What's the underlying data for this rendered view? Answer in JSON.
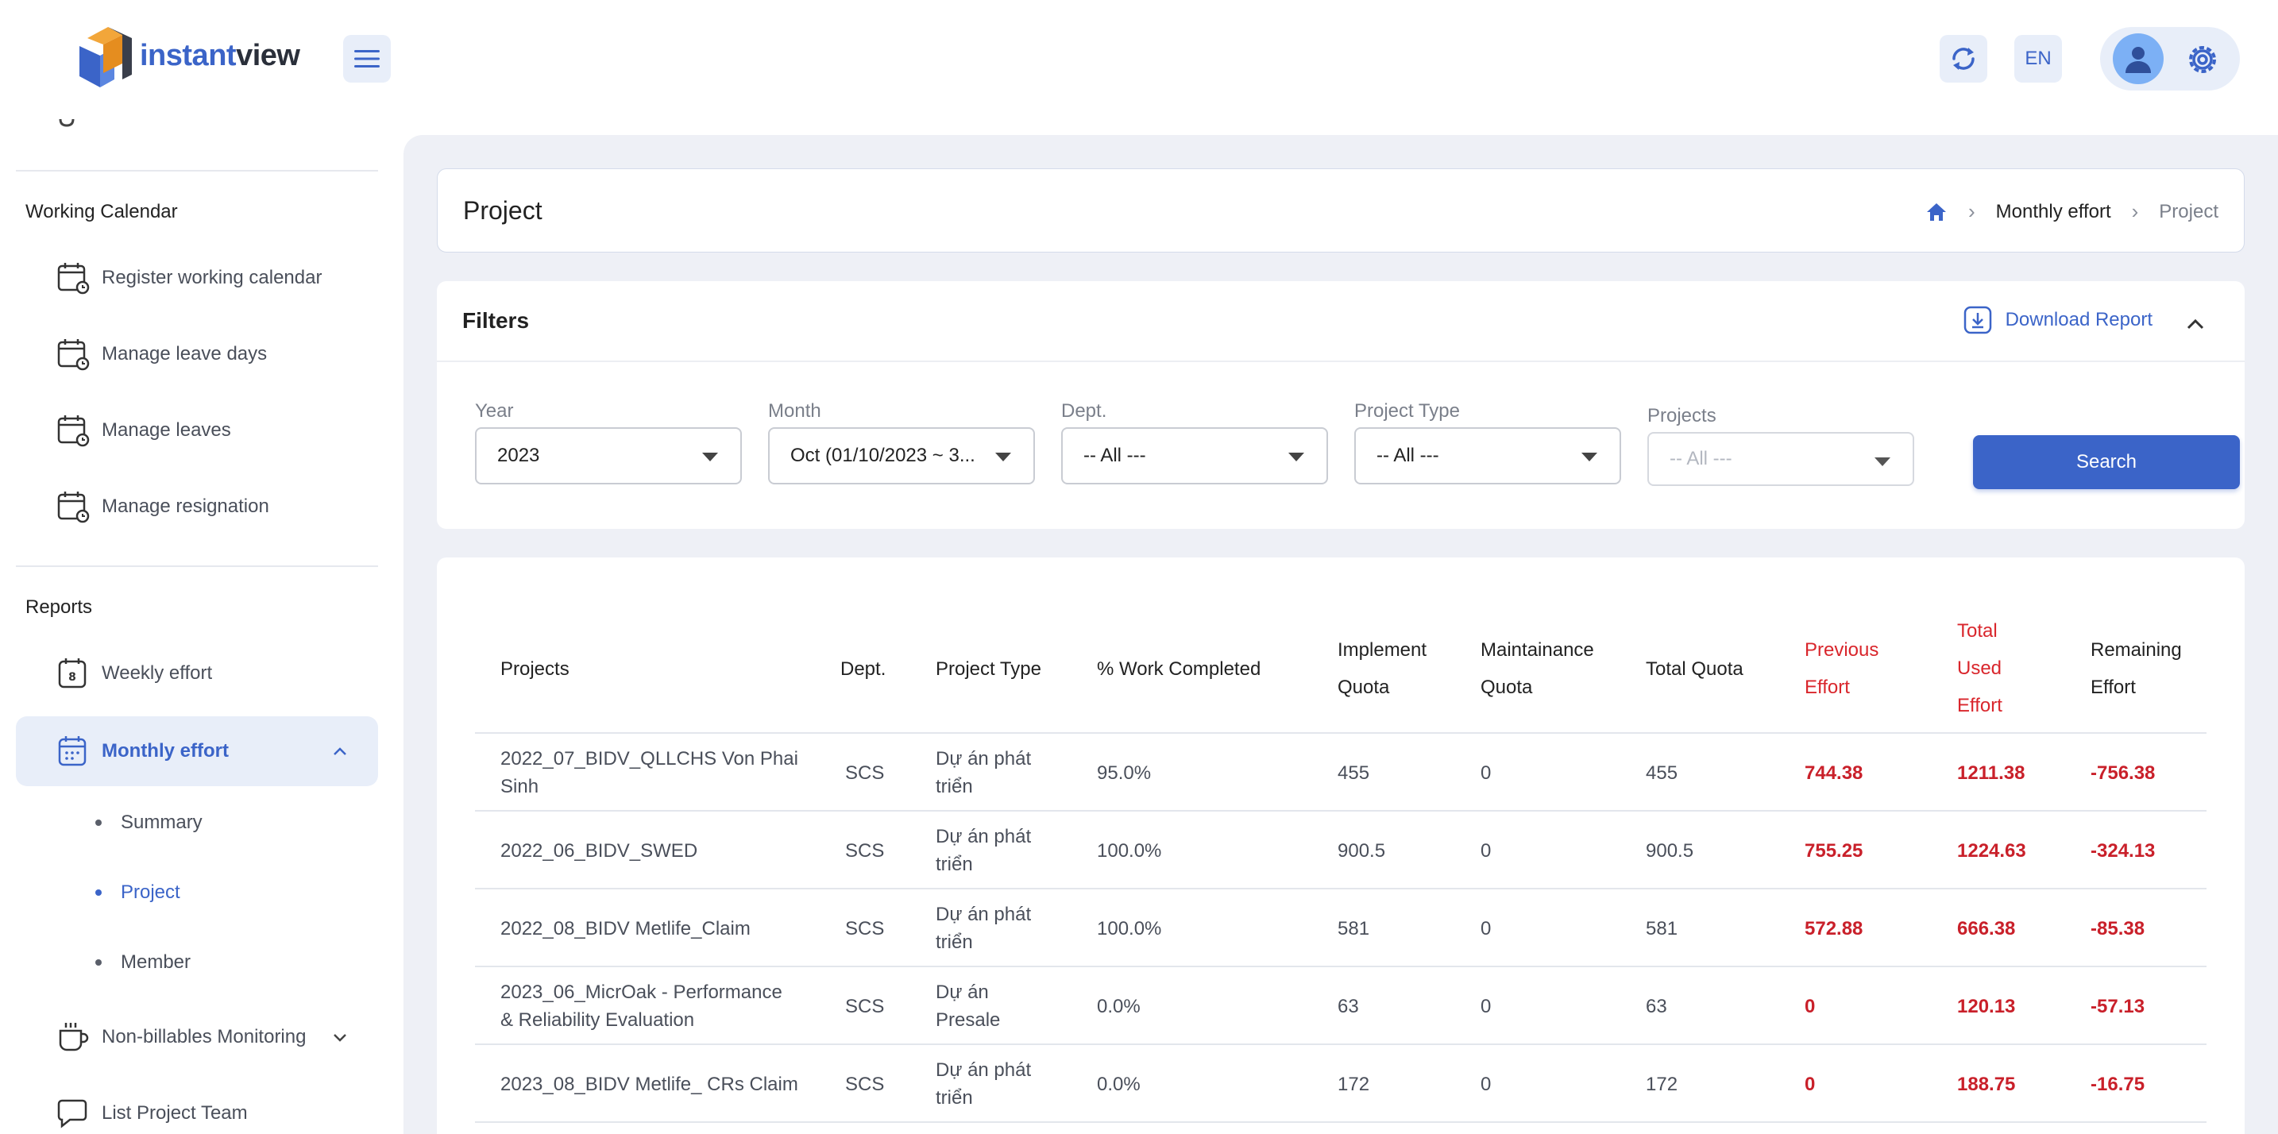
{
  "header": {
    "logo_a": "instant",
    "logo_b": "view",
    "lang": "EN"
  },
  "sidebar": {
    "section_calendar": "Working Calendar",
    "calendar_items": [
      {
        "label": "Register working calendar"
      },
      {
        "label": "Manage leave days"
      },
      {
        "label": "Manage leaves"
      },
      {
        "label": "Manage resignation"
      }
    ],
    "section_reports": "Reports",
    "weekly": "Weekly effort",
    "monthly": "Monthly effort",
    "sub": [
      "Summary",
      "Project",
      "Member"
    ],
    "nonbillables": "Non-billables Monitoring",
    "list_team": "List Project Team"
  },
  "title_card": {
    "title": "Project",
    "breadcrumb_mid": "Monthly effort",
    "breadcrumb_last": "Project"
  },
  "filters": {
    "title": "Filters",
    "download": "Download Report",
    "year_label": "Year",
    "year_value": "2023",
    "month_label": "Month",
    "month_value": "Oct (01/10/2023 ~ 3...",
    "dept_label": "Dept.",
    "dept_value": "-- All ---",
    "ptype_label": "Project Type",
    "ptype_value": "-- All ---",
    "projects_label": "Projects",
    "projects_value": "-- All ---",
    "search": "Search"
  },
  "table": {
    "headers": {
      "projects": "Projects",
      "dept": "Dept.",
      "ptype": "Project Type",
      "work": "% Work Completed",
      "impl_1": "Implement",
      "impl_2": "Quota",
      "maint_1": "Maintainance",
      "maint_2": "Quota",
      "total": "Total Quota",
      "prev_1": "Previous",
      "prev_2": "Effort",
      "used_1": "Total",
      "used_2": "Used",
      "used_3": "Effort",
      "rem_1": "Remaining",
      "rem_2": "Effort"
    },
    "rows": [
      {
        "p1": "2022_07_BIDV_QLLCHS Von Phai",
        "p2": "Sinh",
        "dept": "SCS",
        "t1": "Dự án phát",
        "t2": "triển",
        "work": "95.0%",
        "impl": "455",
        "maint": "0",
        "total": "455",
        "prev": "744.38",
        "used": "1211.38",
        "rem": "-756.38"
      },
      {
        "p1": "2022_06_BIDV_SWED",
        "p2": "",
        "dept": "SCS",
        "t1": "Dự án phát",
        "t2": "triển",
        "work": "100.0%",
        "impl": "900.5",
        "maint": "0",
        "total": "900.5",
        "prev": "755.25",
        "used": "1224.63",
        "rem": "-324.13"
      },
      {
        "p1": "2022_08_BIDV Metlife_Claim",
        "p2": "",
        "dept": "SCS",
        "t1": "Dự án phát",
        "t2": "triển",
        "work": "100.0%",
        "impl": "581",
        "maint": "0",
        "total": "581",
        "prev": "572.88",
        "used": "666.38",
        "rem": "-85.38"
      },
      {
        "p1": "2023_06_MicrOak - Performance",
        "p2": "& Reliability Evaluation",
        "dept": "SCS",
        "t1": "Dự án",
        "t2": "Presale",
        "work": "0.0%",
        "impl": "63",
        "maint": "0",
        "total": "63",
        "prev": "0",
        "used": "120.13",
        "rem": "-57.13"
      },
      {
        "p1": "2023_08_BIDV Metlife_ CRs Claim",
        "p2": "",
        "dept": "SCS",
        "t1": "Dự án phát",
        "t2": "triển",
        "work": "0.0%",
        "impl": "172",
        "maint": "0",
        "total": "172",
        "prev": "0",
        "used": "188.75",
        "rem": "-16.75"
      }
    ]
  },
  "colors": {
    "accent": "#3b64c8",
    "danger": "#c9202a",
    "panel": "#eef0f6"
  }
}
